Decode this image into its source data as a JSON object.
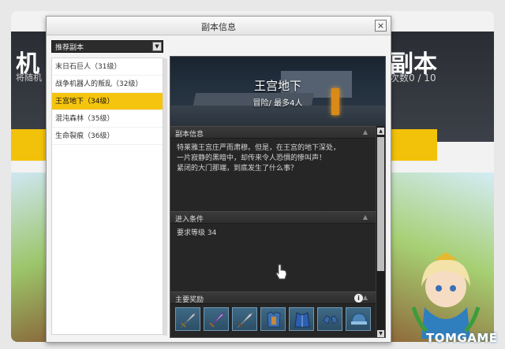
{
  "background": {
    "left_title": "机",
    "left_subtitle": "将随机",
    "right_title": "副本",
    "right_subtitle": "次数0 / 10",
    "watermark": "TOMGAME"
  },
  "dialog": {
    "title": "副本信息",
    "close_label": "×",
    "dropdown_value": "推荐副本",
    "dropdown_arrow": "▼",
    "dungeons": [
      {
        "label": "末日石巨人（31级）",
        "selected": false
      },
      {
        "label": "战争机器人的叛乱（32级）",
        "selected": false
      },
      {
        "label": "王宫地下（34级）",
        "selected": true
      },
      {
        "label": "混沌森林（35级）",
        "selected": false
      },
      {
        "label": "生命裂痕（36级）",
        "selected": false
      }
    ],
    "detail": {
      "name": "王宫地下",
      "mode": "冒险/ 最多4人",
      "info_header": "副本信息",
      "info_lines": [
        "特莱雅王宫庄严而肃穆。但是，在王宫的地下深处，",
        "一片寂静的黑暗中，却传来令人恐惧的惨叫声！",
        "紧闭的大门那端，到底发生了什么事？"
      ],
      "condition_header": "进入条件",
      "condition_text": "要求等级 34",
      "rewards_header": "主要奖励",
      "caret": "▲",
      "info_icon": "i"
    },
    "rewards": [
      {
        "icon": "sword-icon"
      },
      {
        "icon": "sword-purple-icon"
      },
      {
        "icon": "sword-icon"
      },
      {
        "icon": "armor-icon"
      },
      {
        "icon": "robe-icon"
      },
      {
        "icon": "gloves-icon"
      },
      {
        "icon": "helmet-icon"
      }
    ]
  }
}
